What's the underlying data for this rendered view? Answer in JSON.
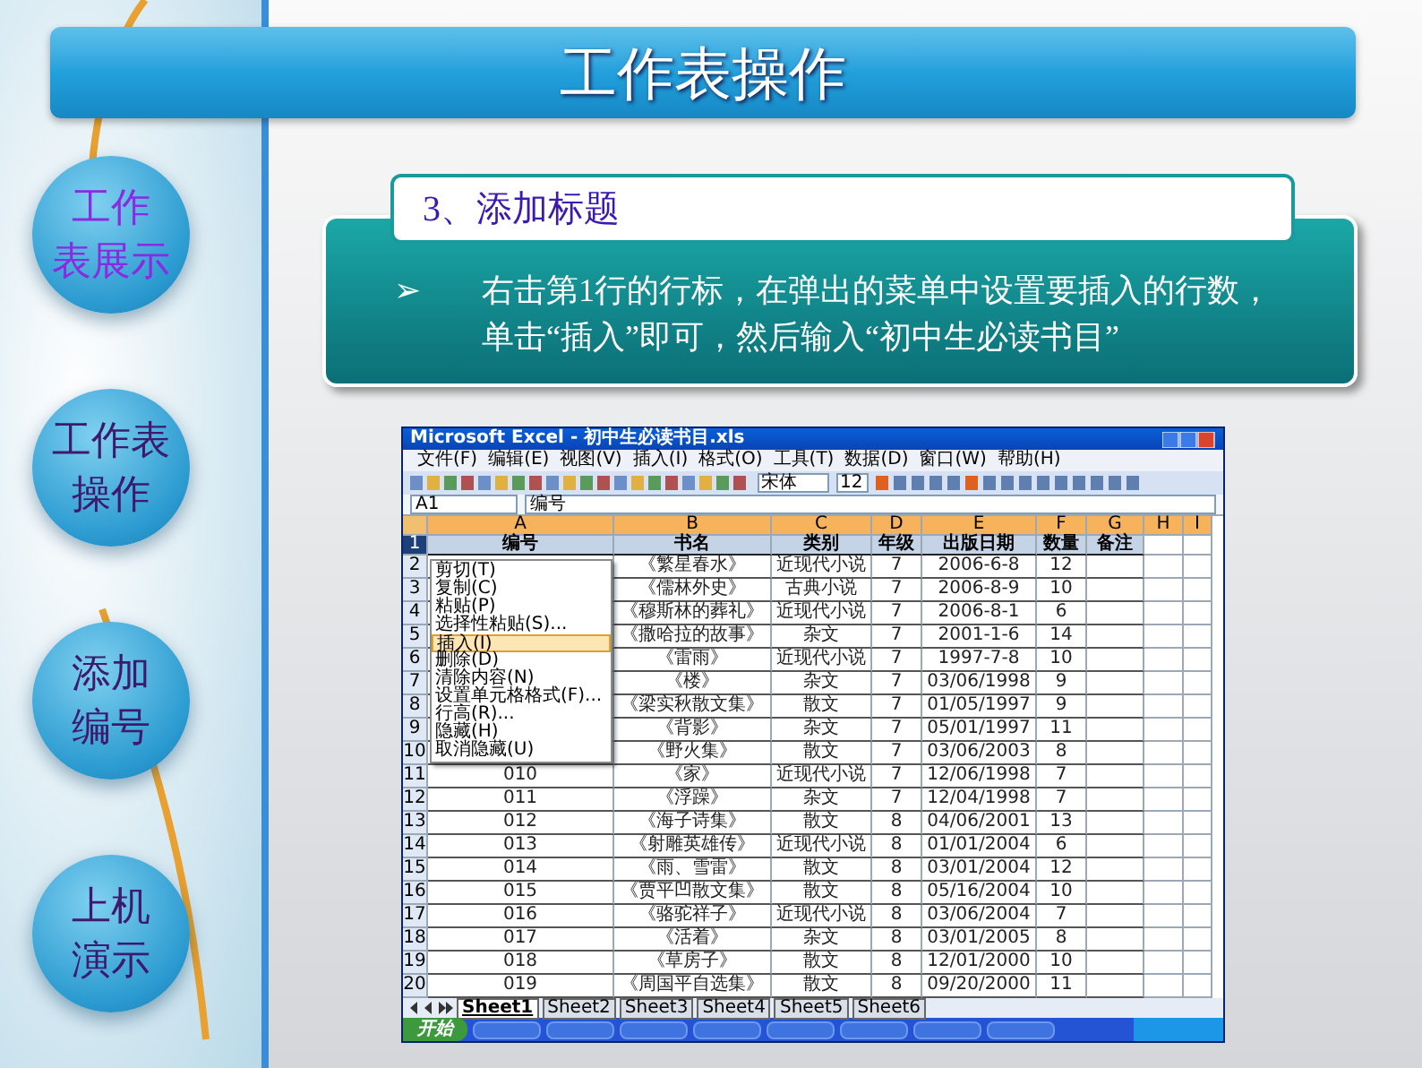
{
  "title": "工作表操作",
  "nav": [
    {
      "lines": [
        "工作",
        "表展示"
      ],
      "visited": true
    },
    {
      "lines": [
        "工作表",
        "操作"
      ],
      "visited": false
    },
    {
      "lines": [
        "添加",
        "编号"
      ],
      "visited": false
    },
    {
      "lines": [
        "上机",
        "演示"
      ],
      "visited": false
    }
  ],
  "subtitle": "3、添加标题",
  "bullet": {
    "marker": "➢",
    "text": "右击第1行的行标，在弹出的菜单中设置要插入的行数，单击“插入”即可，然后输入“初中生必读书目”"
  },
  "excel": {
    "title": "Microsoft Excel - 初中生必读书目.xls",
    "menu": [
      "文件(F)",
      "编辑(E)",
      "视图(V)",
      "插入(I)",
      "格式(O)",
      "工具(T)",
      "数据(D)",
      "窗口(W)",
      "帮助(H)"
    ],
    "font_name": "宋体",
    "font_size": "12",
    "name_box": "A1",
    "formula": "编号",
    "columns": [
      "A",
      "B",
      "C",
      "D",
      "E",
      "F",
      "G",
      "H",
      "I"
    ],
    "header": {
      "num": "1",
      "cells": [
        "编号",
        "书名",
        "类别",
        "年级",
        "出版日期",
        "数量",
        "备注"
      ]
    },
    "rows": [
      {
        "num": "2",
        "title": "《繁星春水》",
        "category": "近现代小说",
        "grade": "7",
        "date": "2006-6-8",
        "qty": "12"
      },
      {
        "num": "3",
        "title": "《儒林外史》",
        "category": "古典小说",
        "grade": "7",
        "date": "2006-8-9",
        "qty": "10"
      },
      {
        "num": "4",
        "title": "《穆斯林的葬礼》",
        "category": "近现代小说",
        "grade": "7",
        "date": "2006-8-1",
        "qty": "6"
      },
      {
        "num": "5",
        "title": "《撒哈拉的故事》",
        "category": "杂文",
        "grade": "7",
        "date": "2001-1-6",
        "qty": "14"
      },
      {
        "num": "6",
        "title": "《雷雨》",
        "category": "近现代小说",
        "grade": "7",
        "date": "1997-7-8",
        "qty": "10"
      },
      {
        "num": "7",
        "title": "《楼》",
        "category": "杂文",
        "grade": "7",
        "date": "03/06/1998",
        "qty": "9"
      },
      {
        "num": "8",
        "title": "《梁实秋散文集》",
        "category": "散文",
        "grade": "7",
        "date": "01/05/1997",
        "qty": "9"
      },
      {
        "num": "9",
        "title": "《背影》",
        "category": "杂文",
        "grade": "7",
        "date": "05/01/1997",
        "qty": "11"
      },
      {
        "num": "10",
        "title": "《野火集》",
        "category": "散文",
        "grade": "7",
        "date": "03/06/2003",
        "qty": "8"
      },
      {
        "num": "11",
        "code": "010",
        "title": "《家》",
        "category": "近现代小说",
        "grade": "7",
        "date": "12/06/1998",
        "qty": "7"
      },
      {
        "num": "12",
        "code": "011",
        "title": "《浮躁》",
        "category": "杂文",
        "grade": "7",
        "date": "12/04/1998",
        "qty": "7"
      },
      {
        "num": "13",
        "code": "012",
        "title": "《海子诗集》",
        "category": "散文",
        "grade": "8",
        "date": "04/06/2001",
        "qty": "13"
      },
      {
        "num": "14",
        "code": "013",
        "title": "《射雕英雄传》",
        "category": "近现代小说",
        "grade": "8",
        "date": "01/01/2004",
        "qty": "6"
      },
      {
        "num": "15",
        "code": "014",
        "title": "《雨、雪雷》",
        "category": "散文",
        "grade": "8",
        "date": "03/01/2004",
        "qty": "12"
      },
      {
        "num": "16",
        "code": "015",
        "title": "《贾平凹散文集》",
        "category": "散文",
        "grade": "8",
        "date": "05/16/2004",
        "qty": "10"
      },
      {
        "num": "17",
        "code": "016",
        "title": "《骆驼祥子》",
        "category": "近现代小说",
        "grade": "8",
        "date": "03/06/2004",
        "qty": "7"
      },
      {
        "num": "18",
        "code": "017",
        "title": "《活着》",
        "category": "杂文",
        "grade": "8",
        "date": "03/01/2005",
        "qty": "8"
      },
      {
        "num": "19",
        "code": "018",
        "title": "《草房子》",
        "category": "散文",
        "grade": "8",
        "date": "12/01/2000",
        "qty": "10"
      },
      {
        "num": "20",
        "code": "019",
        "title": "《周国平自选集》",
        "category": "散文",
        "grade": "8",
        "date": "09/20/2000",
        "qty": "11"
      }
    ],
    "context_menu": [
      {
        "label": "剪切(T)",
        "highlighted": false
      },
      {
        "label": "复制(C)",
        "highlighted": false
      },
      {
        "label": "粘贴(P)",
        "highlighted": false
      },
      {
        "label": "选择性粘贴(S)...",
        "highlighted": false
      },
      {
        "label": "插入(I)",
        "highlighted": true
      },
      {
        "label": "删除(D)",
        "highlighted": false
      },
      {
        "label": "清除内容(N)",
        "highlighted": false
      },
      {
        "label": "设置单元格格式(F)...",
        "highlighted": false
      },
      {
        "label": "行高(R)...",
        "highlighted": false
      },
      {
        "label": "隐藏(H)",
        "highlighted": false
      },
      {
        "label": "取消隐藏(U)",
        "highlighted": false
      }
    ],
    "sheets": [
      {
        "label": "Sheet1",
        "selected": true
      },
      {
        "label": "Sheet2",
        "selected": false
      },
      {
        "label": "Sheet3",
        "selected": false
      },
      {
        "label": "Sheet4",
        "selected": false
      },
      {
        "label": "Sheet5",
        "selected": false
      },
      {
        "label": "Sheet6",
        "selected": false
      }
    ],
    "start_button": "开始"
  }
}
